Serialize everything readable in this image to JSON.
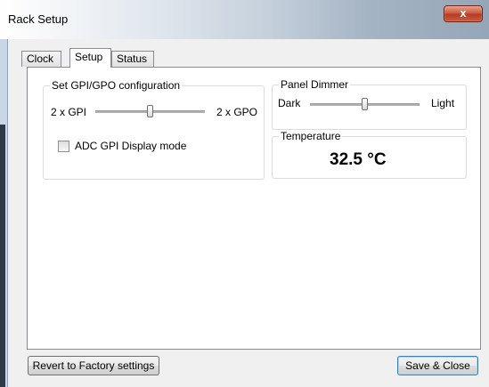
{
  "window": {
    "title": "Rack Setup",
    "close_glyph": "x"
  },
  "tabs": [
    {
      "label": "Clock"
    },
    {
      "label": "Setup"
    },
    {
      "label": "Status"
    }
  ],
  "active_tab": "Setup",
  "gpio": {
    "group_label": "Set GPI/GPO configuration",
    "left_label": "2 x GPI",
    "right_label": "2 x GPO",
    "slider_value": 0.5,
    "checkbox_label": "ADC GPI Display mode",
    "checkbox_checked": false
  },
  "dimmer": {
    "group_label": "Panel Dimmer",
    "left_label": "Dark",
    "right_label": "Light",
    "slider_value": 0.5
  },
  "temperature": {
    "group_label": "Temperature",
    "value": "32.5 °C"
  },
  "footer": {
    "revert_label": "Revert to Factory settings",
    "save_label": "Save & Close"
  }
}
